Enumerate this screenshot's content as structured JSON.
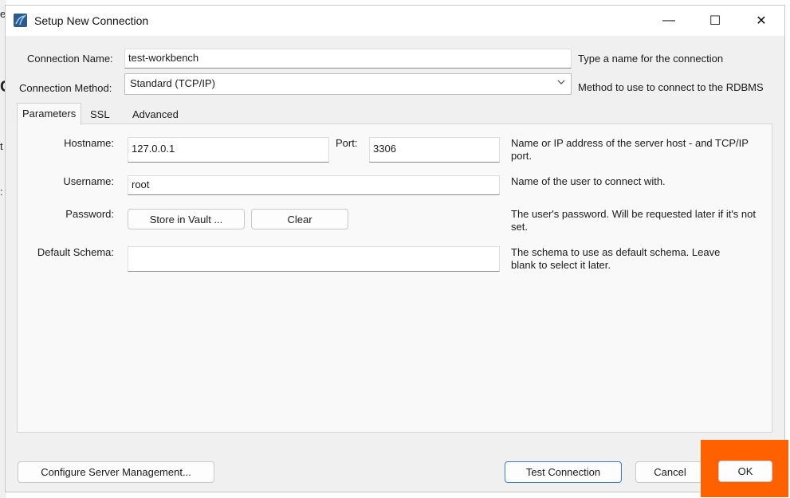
{
  "window": {
    "title": "Setup New Connection",
    "minimize_glyph": "—",
    "maximize_glyph": "☐",
    "close_glyph": "✕"
  },
  "background_fragments": [
    "e",
    "C",
    "t",
    ":"
  ],
  "connection_name": {
    "label": "Connection Name:",
    "value": "test-workbench",
    "help": "Type a name for the connection"
  },
  "connection_method": {
    "label": "Connection Method:",
    "value": "Standard (TCP/IP)",
    "help": "Method to use to connect to the RDBMS"
  },
  "tabs": [
    {
      "label": "Parameters"
    },
    {
      "label": "SSL"
    },
    {
      "label": "Advanced"
    }
  ],
  "parameters": {
    "hostname": {
      "label": "Hostname:",
      "value": "127.0.0.1"
    },
    "port": {
      "label": "Port:",
      "value": "3306"
    },
    "host_help": "Name or IP address of the server host - and TCP/IP port.",
    "username": {
      "label": "Username:",
      "value": "root",
      "help": "Name of the user to connect with."
    },
    "password": {
      "label": "Password:",
      "store_button": "Store in Vault ...",
      "clear_button": "Clear",
      "help": "The user's password. Will be requested later if it's not set."
    },
    "default_schema": {
      "label": "Default Schema:",
      "value": "",
      "help": "The schema to use as default schema. Leave blank to select it later."
    }
  },
  "footer": {
    "configure_button": "Configure Server Management...",
    "test_button": "Test Connection",
    "cancel_button": "Cancel",
    "ok_button": "OK"
  },
  "colors": {
    "highlight": "#ff6000",
    "primary_border": "#3d79c8"
  }
}
